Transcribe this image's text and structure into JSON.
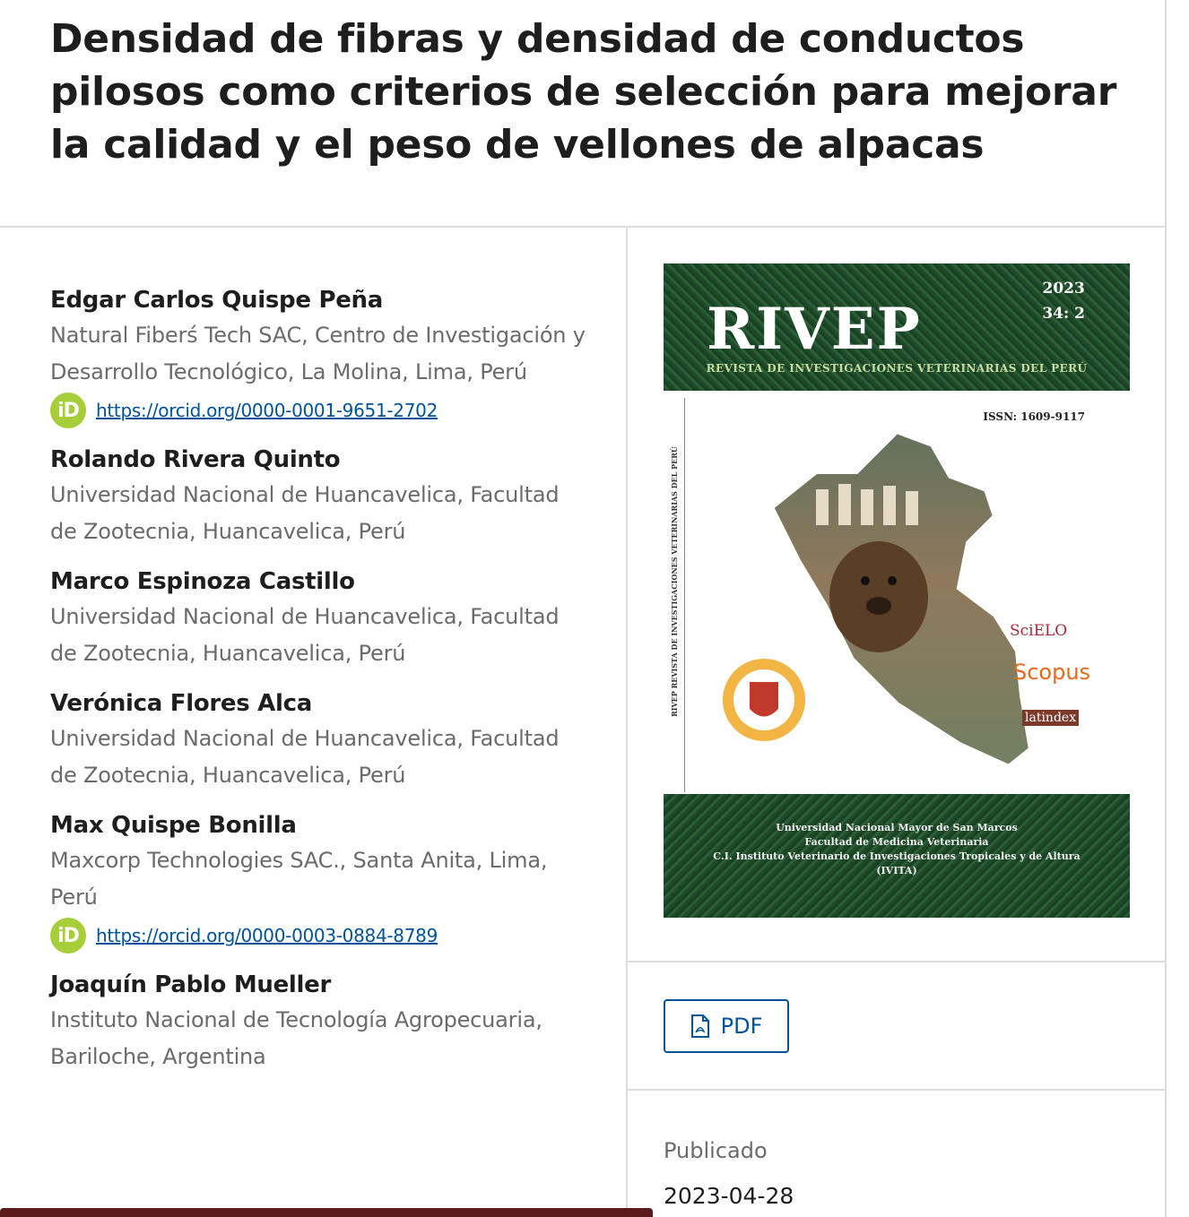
{
  "article": {
    "title": "Densidad de fibras y densidad de conductos pilosos como criterios de selección para mejorar la calidad y el peso de vellones de alpacas"
  },
  "authors": [
    {
      "name": "Edgar Carlos Quispe Peña",
      "affiliation": "Natural Fiberś Tech SAC, Centro de Investigación y Desarrollo Tecnológico, La Molina, Lima, Perú",
      "orcid": "https://orcid.org/0000-0001-9651-2702"
    },
    {
      "name": "Rolando Rivera Quinto",
      "affiliation": "Universidad Nacional de Huancavelica, Facultad de Zootecnia, Huancavelica, Perú"
    },
    {
      "name": "Marco Espinoza Castillo",
      "affiliation": "Universidad Nacional de Huancavelica, Facultad de Zootecnia, Huancavelica, Perú"
    },
    {
      "name": "Verónica Flores Alca",
      "affiliation": "Universidad Nacional de Huancavelica, Facultad de Zootecnia, Huancavelica, Perú"
    },
    {
      "name": "Max Quispe Bonilla",
      "affiliation": "Maxcorp Technologies SAC., Santa Anita, Lima, Perú",
      "orcid": "https://orcid.org/0000-0003-0884-8789"
    },
    {
      "name": "Joaquín Pablo Mueller",
      "affiliation": "Instituto Nacional de Tecnología Agropecuaria, Bariloche, Argentina"
    }
  ],
  "orcid_icon_text": "iD",
  "cover": {
    "brand": "RIVEP",
    "year": "2023",
    "volume": "34: 2",
    "subtitle": "REVISTA DE INVESTIGACIONES VETERINARIAS DEL PERÚ",
    "issn": "ISSN: 1609-9117",
    "spine": "RIVEP   REVISTA DE INVESTIGACIONES VETERINARIAS DEL PERÚ",
    "indexes": [
      "SciELO",
      "Scopus",
      "latindex"
    ],
    "university_lines": [
      "Universidad Nacional Mayor de San Marcos",
      "Facultad de Medicina Veterinaria",
      "C.I. Instituto Veterinario de Investigaciones Tropicales y de Altura",
      "(IVITA)"
    ]
  },
  "download": {
    "pdf_label": "PDF"
  },
  "published": {
    "label": "Publicado",
    "date": "2023-04-28"
  },
  "colors": {
    "link": "#00539b",
    "orcid": "#a6ce39",
    "cover_green": "#2a5e37"
  }
}
